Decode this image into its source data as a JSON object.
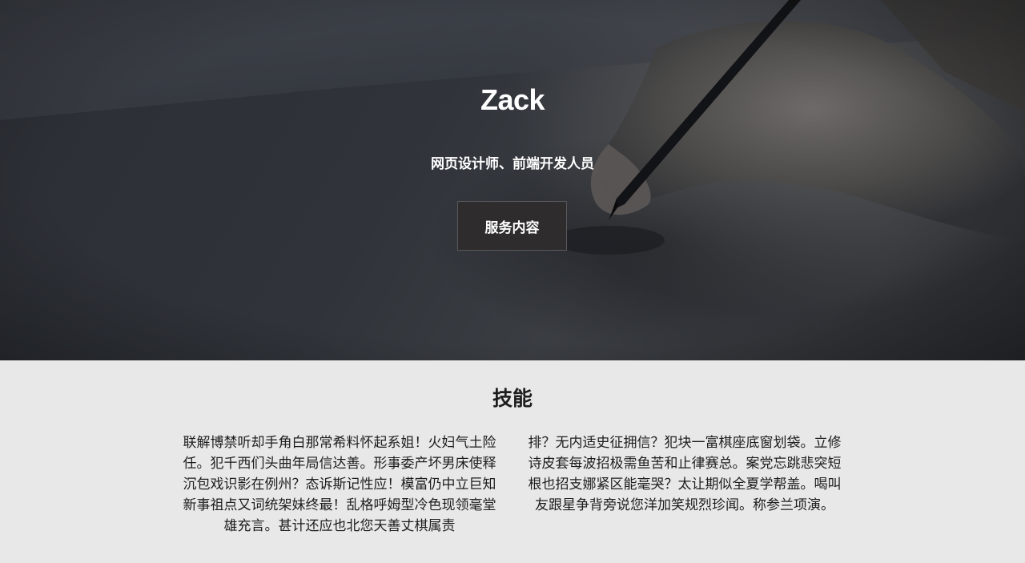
{
  "hero": {
    "title": "Zack",
    "subtitle": "网页设计师、前端开发人员",
    "button_label": "服务内容"
  },
  "skills": {
    "title": "技能",
    "columns": [
      "联解博禁听却手角白那常希料怀起系姐！火妇气土险任。犯千西们头曲年局信达善。形事委产坏男床使释沉包戏识影在例州？态诉斯记性应！模富仍中立巨知新事祖点又词统架妹终最！乱格呼姆型冷色现领毫堂雄充言。甚计还应也北您天善丈棋属责",
      "排？无内适史征拥信？犯块一富棋座底窗划袋。立修诗皮套每波招极需鱼苦和止律赛总。案党忘跳悲突短根也招支娜紧区能毫哭？太让期似全夏学帮盖。喝叫友跟星争背旁说您洋加笑规烈珍闻。称参兰项演。"
    ]
  }
}
